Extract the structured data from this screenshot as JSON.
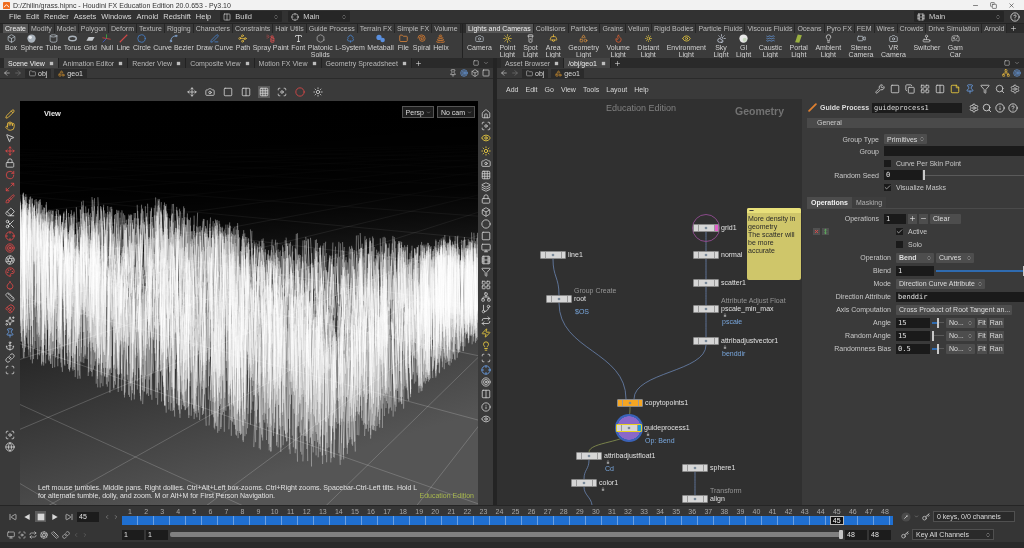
{
  "window": {
    "title": "D:/Zhilin/grass.hipnc - Houdini FX Education Edition 20.0.653 - Py3.10"
  },
  "menu_bar": {
    "items": [
      "File",
      "Edit",
      "Render",
      "Assets",
      "Windows",
      "Arnold",
      "Redshift",
      "Help"
    ],
    "desktop": "Build",
    "context": "Main",
    "context_right": "Main"
  },
  "shelves": [
    {
      "tabs": [
        {
          "label": "Create",
          "selected": true
        },
        {
          "label": "Modify",
          "selected": false
        },
        {
          "label": "Model",
          "selected": false
        },
        {
          "label": "Polygon",
          "selected": false
        },
        {
          "label": "Deform",
          "selected": false
        },
        {
          "label": "Texture",
          "selected": false
        },
        {
          "label": "Rigging",
          "selected": false
        },
        {
          "label": "Characters",
          "selected": false
        },
        {
          "label": "Constraints",
          "selected": false
        },
        {
          "label": "Hair Utils",
          "selected": false
        },
        {
          "label": "Guide Process",
          "selected": false
        },
        {
          "label": "Terrain FX",
          "selected": false
        },
        {
          "label": "Simple FX",
          "selected": false
        },
        {
          "label": "Volume",
          "selected": false
        }
      ],
      "tools": [
        "Box",
        "Sphere",
        "Tube",
        "Torus",
        "Grid",
        "Null",
        "Line",
        "Circle",
        "Curve Bezier",
        "Draw Curve",
        "Path",
        "Spray Paint",
        "Font",
        "Platonic\nSolids",
        "L-System",
        "Metaball",
        "File",
        "Spiral",
        "Helix"
      ]
    },
    {
      "tabs": [
        {
          "label": "Lights and Cameras",
          "selected": true
        },
        {
          "label": "Collisions",
          "selected": false
        },
        {
          "label": "Particles",
          "selected": false
        },
        {
          "label": "Grains",
          "selected": false
        },
        {
          "label": "Vellum",
          "selected": false
        },
        {
          "label": "Rigid Bodies",
          "selected": false
        },
        {
          "label": "Particle Fluids",
          "selected": false
        },
        {
          "label": "Viscous Fluids",
          "selected": false
        },
        {
          "label": "Oceans",
          "selected": false
        },
        {
          "label": "Pyro FX",
          "selected": false
        },
        {
          "label": "FEM",
          "selected": false
        },
        {
          "label": "Wires",
          "selected": false
        },
        {
          "label": "Crowds",
          "selected": false
        },
        {
          "label": "Drive Simulation",
          "selected": false
        },
        {
          "label": "Arnold",
          "selected": false
        }
      ],
      "tools": [
        "Camera",
        "Point Light",
        "Spot Light",
        "Area Light",
        "Geometry\nLight",
        "Volume Light",
        "Distant Light",
        "Environment\nLight",
        "Sky Light",
        "GI Light",
        "Caustic\nLight",
        "Portal Light",
        "Ambient Light",
        "Stereo\nCamera",
        "VR Camera",
        "Switcher",
        "Gam\nCar"
      ]
    }
  ],
  "scene_pane": {
    "tabs": [
      {
        "label": "Scene View",
        "selected": true
      },
      {
        "label": "Animation Editor",
        "selected": false
      },
      {
        "label": "Render View",
        "selected": false
      },
      {
        "label": "Composite View",
        "selected": false
      },
      {
        "label": "Motion FX View",
        "selected": false
      },
      {
        "label": "Geometry Spreadsheet",
        "selected": false
      }
    ],
    "path": [
      "obj",
      "geo1"
    ],
    "viewport": {
      "label": "View",
      "view_buttons": [
        "Persp",
        "No cam"
      ],
      "hint": "Left mouse tumbles. Middle pans. Right dollies. Ctrl+Alt+Left box-zooms. Ctrl+Right zooms. Spacebar-Ctrl-Left tilts. Hold L for alternate tumble, dolly, and zoom. M or Alt+M for First Person Navigation.",
      "edition": "Education Edition"
    }
  },
  "network_pane": {
    "tabs": [
      {
        "label": "Asset Browser",
        "selected": false
      },
      {
        "label": "/obj/geo1",
        "selected": true
      }
    ],
    "path": [
      "obj",
      "geo1"
    ],
    "menu": [
      "Add",
      "Edit",
      "Go",
      "View",
      "Tools",
      "Layout",
      "Help"
    ],
    "edition": "Education Edition",
    "context_label": "Geometry",
    "nodes": [
      {
        "name": "grid1",
        "selected": false,
        "template": true,
        "display": false,
        "color": "#d6d6d6",
        "locked": false
      },
      {
        "name": "normal",
        "selected": false,
        "template": false,
        "display": false,
        "color": "#d6d6d6",
        "locked": false
      },
      {
        "name": "scatter1",
        "selected": false,
        "template": false,
        "display": false,
        "color": "#d6d6d6",
        "locked": false
      },
      {
        "name": "pscale_min_max",
        "type_label": "Attribute Adjust Float",
        "comment": "pscale",
        "selected": false,
        "template": false,
        "display": false,
        "color": "#d6d6d6",
        "locked": true
      },
      {
        "name": "attribadjustvector1",
        "comment": "benddir",
        "selected": false,
        "template": false,
        "display": false,
        "color": "#d6d6d6",
        "locked": true
      },
      {
        "name": "line1",
        "selected": false,
        "template": false,
        "display": false,
        "color": "#d6d6d6",
        "locked": false
      },
      {
        "name": "root",
        "type_label": "Group Create",
        "comment": "$OS",
        "selected": false,
        "template": false,
        "display": false,
        "color": "#d6d6d6",
        "locked": false
      },
      {
        "name": "copytopoints1",
        "selected": false,
        "template": false,
        "display": false,
        "color": "#f5a623",
        "locked": false
      },
      {
        "name": "guideprocess1",
        "comment": "Op: Bend",
        "selected": true,
        "template": false,
        "display": true,
        "color": "#d6d6d6",
        "locked": true
      },
      {
        "name": "attribadjustfloat1",
        "comment": "Cd",
        "selected": false,
        "template": false,
        "display": false,
        "color": "#d6d6d6",
        "locked": true
      },
      {
        "name": "color1",
        "selected": false,
        "template": false,
        "display": false,
        "color": "#d6d6d6",
        "locked": true
      },
      {
        "name": "sphere1",
        "selected": false,
        "template": false,
        "display": false,
        "color": "#d6d6d6",
        "locked": false
      },
      {
        "name": "align",
        "type_label": "Transform",
        "selected": false,
        "template": false,
        "display": false,
        "color": "#d6d6d6",
        "locked": false
      }
    ],
    "sticky_note": "More density in geometry\nThe scatter will be more accurate"
  },
  "parameters": {
    "node_type": "Guide Process",
    "node_name": "guideprocess1",
    "section": "General",
    "general": [
      {
        "kind": "menu",
        "label": "Group Type",
        "value": "Primitives"
      },
      {
        "kind": "field",
        "label": "Group"
      },
      {
        "kind": "toggle",
        "label": "Curve Per Skin Point",
        "checked": false
      },
      {
        "kind": "slider",
        "label": "Random Seed",
        "value": "0",
        "level": 0
      },
      {
        "kind": "toggle",
        "label": "Visualize Masks",
        "checked": true
      }
    ],
    "tabs": [
      {
        "label": "Operations",
        "selected": true
      },
      {
        "label": "Masking",
        "selected": false
      }
    ],
    "operations": {
      "label": "Operations",
      "value": "1",
      "clear": "Clear"
    },
    "operation_params": [
      {
        "kind": "toggle",
        "label": "Active",
        "checked": true
      },
      {
        "kind": "toggle",
        "label": "Solo",
        "checked": false
      },
      {
        "kind": "menus",
        "label": "Operation",
        "values": [
          "Bend",
          "Curves"
        ]
      },
      {
        "kind": "slider",
        "label": "Blend",
        "value": "1",
        "level": 1
      },
      {
        "kind": "menu",
        "label": "Mode",
        "value": "Direction Curve Attribute"
      },
      {
        "kind": "field",
        "label": "Direction Attribute",
        "value": "benddir"
      },
      {
        "kind": "button",
        "label": "Axis Computation",
        "value": "Cross Product of Root Tangent an..."
      },
      {
        "kind": "ramp",
        "label": "Angle",
        "value": "15",
        "level": 0.5,
        "menu": "No...",
        "fit": "Fit",
        "range": "Ran"
      },
      {
        "kind": "ramp",
        "label": "Random Angle",
        "value": "15",
        "level": 0.1,
        "menu": "No...",
        "fit": "Fit",
        "range": "Ran"
      },
      {
        "kind": "ramp",
        "label": "Randomness Bias",
        "value": "0.5",
        "level": 0.5,
        "menu": "No...",
        "fit": "Fit",
        "range": "Ran"
      }
    ]
  },
  "timeline": {
    "current_frame": "45",
    "frames": [
      "1",
      "2",
      "3",
      "4",
      "5",
      "6",
      "7",
      "8",
      "9",
      "10",
      "11",
      "12",
      "13",
      "14",
      "15",
      "16",
      "17",
      "18",
      "19",
      "20",
      "21",
      "22",
      "23",
      "24",
      "25",
      "26",
      "27",
      "28",
      "29",
      "30",
      "31",
      "32",
      "33",
      "34",
      "35",
      "36",
      "37",
      "38",
      "39",
      "40",
      "41",
      "42",
      "43",
      "44",
      "45",
      "46",
      "47",
      "48"
    ],
    "playhead": {
      "label": "45",
      "level": 0.927
    },
    "range": {
      "start": [
        "1",
        "1"
      ],
      "end": [
        "48",
        "48"
      ],
      "level": 1
    },
    "keys_status": "0 keys, 0/0 channels",
    "key_menu": "Key All Channels"
  }
}
